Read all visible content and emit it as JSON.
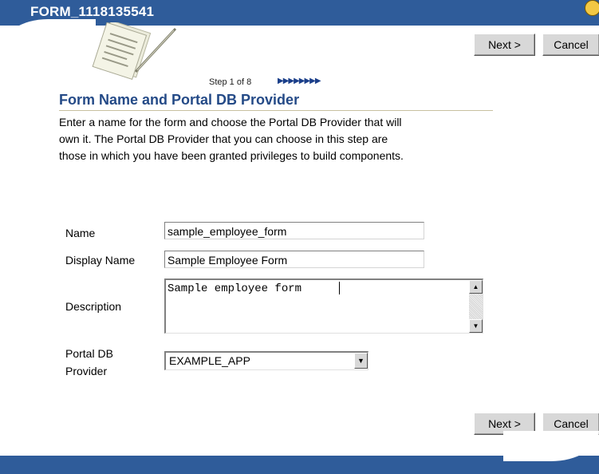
{
  "header": {
    "title": "FORM_1118135541",
    "help_icon": "?"
  },
  "buttons": {
    "next": "Next >",
    "cancel": "Cancel"
  },
  "step": {
    "label": "Step 1 of 8",
    "total_steps": 8,
    "current_step": 1,
    "arrows": "▶▶▶▶▶▶▶▶"
  },
  "section": {
    "heading": "Form Name and Portal DB Provider",
    "intro_lines": [
      "Enter a name for the form and choose the Portal DB Provider that will",
      "own it. The Portal DB Provider that you can choose in this step are",
      "those in which you have been granted privileges to build components."
    ]
  },
  "fields": {
    "name": {
      "label": "Name",
      "value": "sample_employee_form"
    },
    "display_name": {
      "label": "Display Name",
      "value": "Sample Employee Form"
    },
    "description": {
      "label": "Description",
      "value": "Sample employee form"
    },
    "provider": {
      "label_line1": "Portal DB",
      "label_line2": "Provider",
      "value": "EXAMPLE_APP"
    }
  },
  "icons": {
    "up": "▲",
    "down": "▼",
    "dropdown": "▼",
    "illustration": "wizard-document-pen-icon"
  },
  "colors": {
    "header_blue": "#2f5c9a",
    "heading_blue": "#244a87",
    "button_gray": "#d8d8d8"
  }
}
